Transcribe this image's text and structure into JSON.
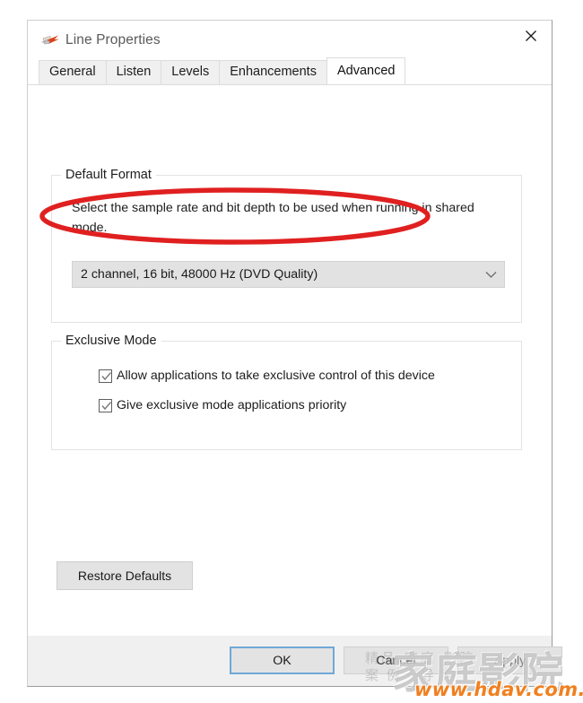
{
  "window": {
    "title": "Line Properties",
    "icon": "line-in-audio-jack-icon",
    "close_label": "✕"
  },
  "tabs": [
    {
      "label": "General",
      "active": false
    },
    {
      "label": "Listen",
      "active": false
    },
    {
      "label": "Levels",
      "active": false
    },
    {
      "label": "Enhancements",
      "active": false
    },
    {
      "label": "Advanced",
      "active": true
    }
  ],
  "default_format": {
    "legend": "Default Format",
    "description": "Select the sample rate and bit depth to be used when running in shared mode.",
    "selected_value": "2 channel, 16 bit, 48000 Hz (DVD Quality)",
    "dropdown_icon": "chevron-down-icon"
  },
  "exclusive_mode": {
    "legend": "Exclusive Mode",
    "checkboxes": [
      {
        "label": "Allow applications to take exclusive control of this device",
        "checked": true
      },
      {
        "label": "Give exclusive mode applications priority",
        "checked": true
      }
    ]
  },
  "buttons": {
    "restore_defaults": "Restore Defaults",
    "ok": "OK",
    "cancel": "Cancel",
    "apply": "Apply"
  },
  "annotation": {
    "shape": "ellipse",
    "color": "#e02020",
    "target": "default-format-dropdown"
  },
  "watermark": {
    "cn_big": "家庭影院",
    "cn_small_line1": "精品 家庭 影院",
    "cn_small_line2": "案例 导购",
    "url": "www.hdav.com.cn",
    "url_color": "#f08020"
  }
}
